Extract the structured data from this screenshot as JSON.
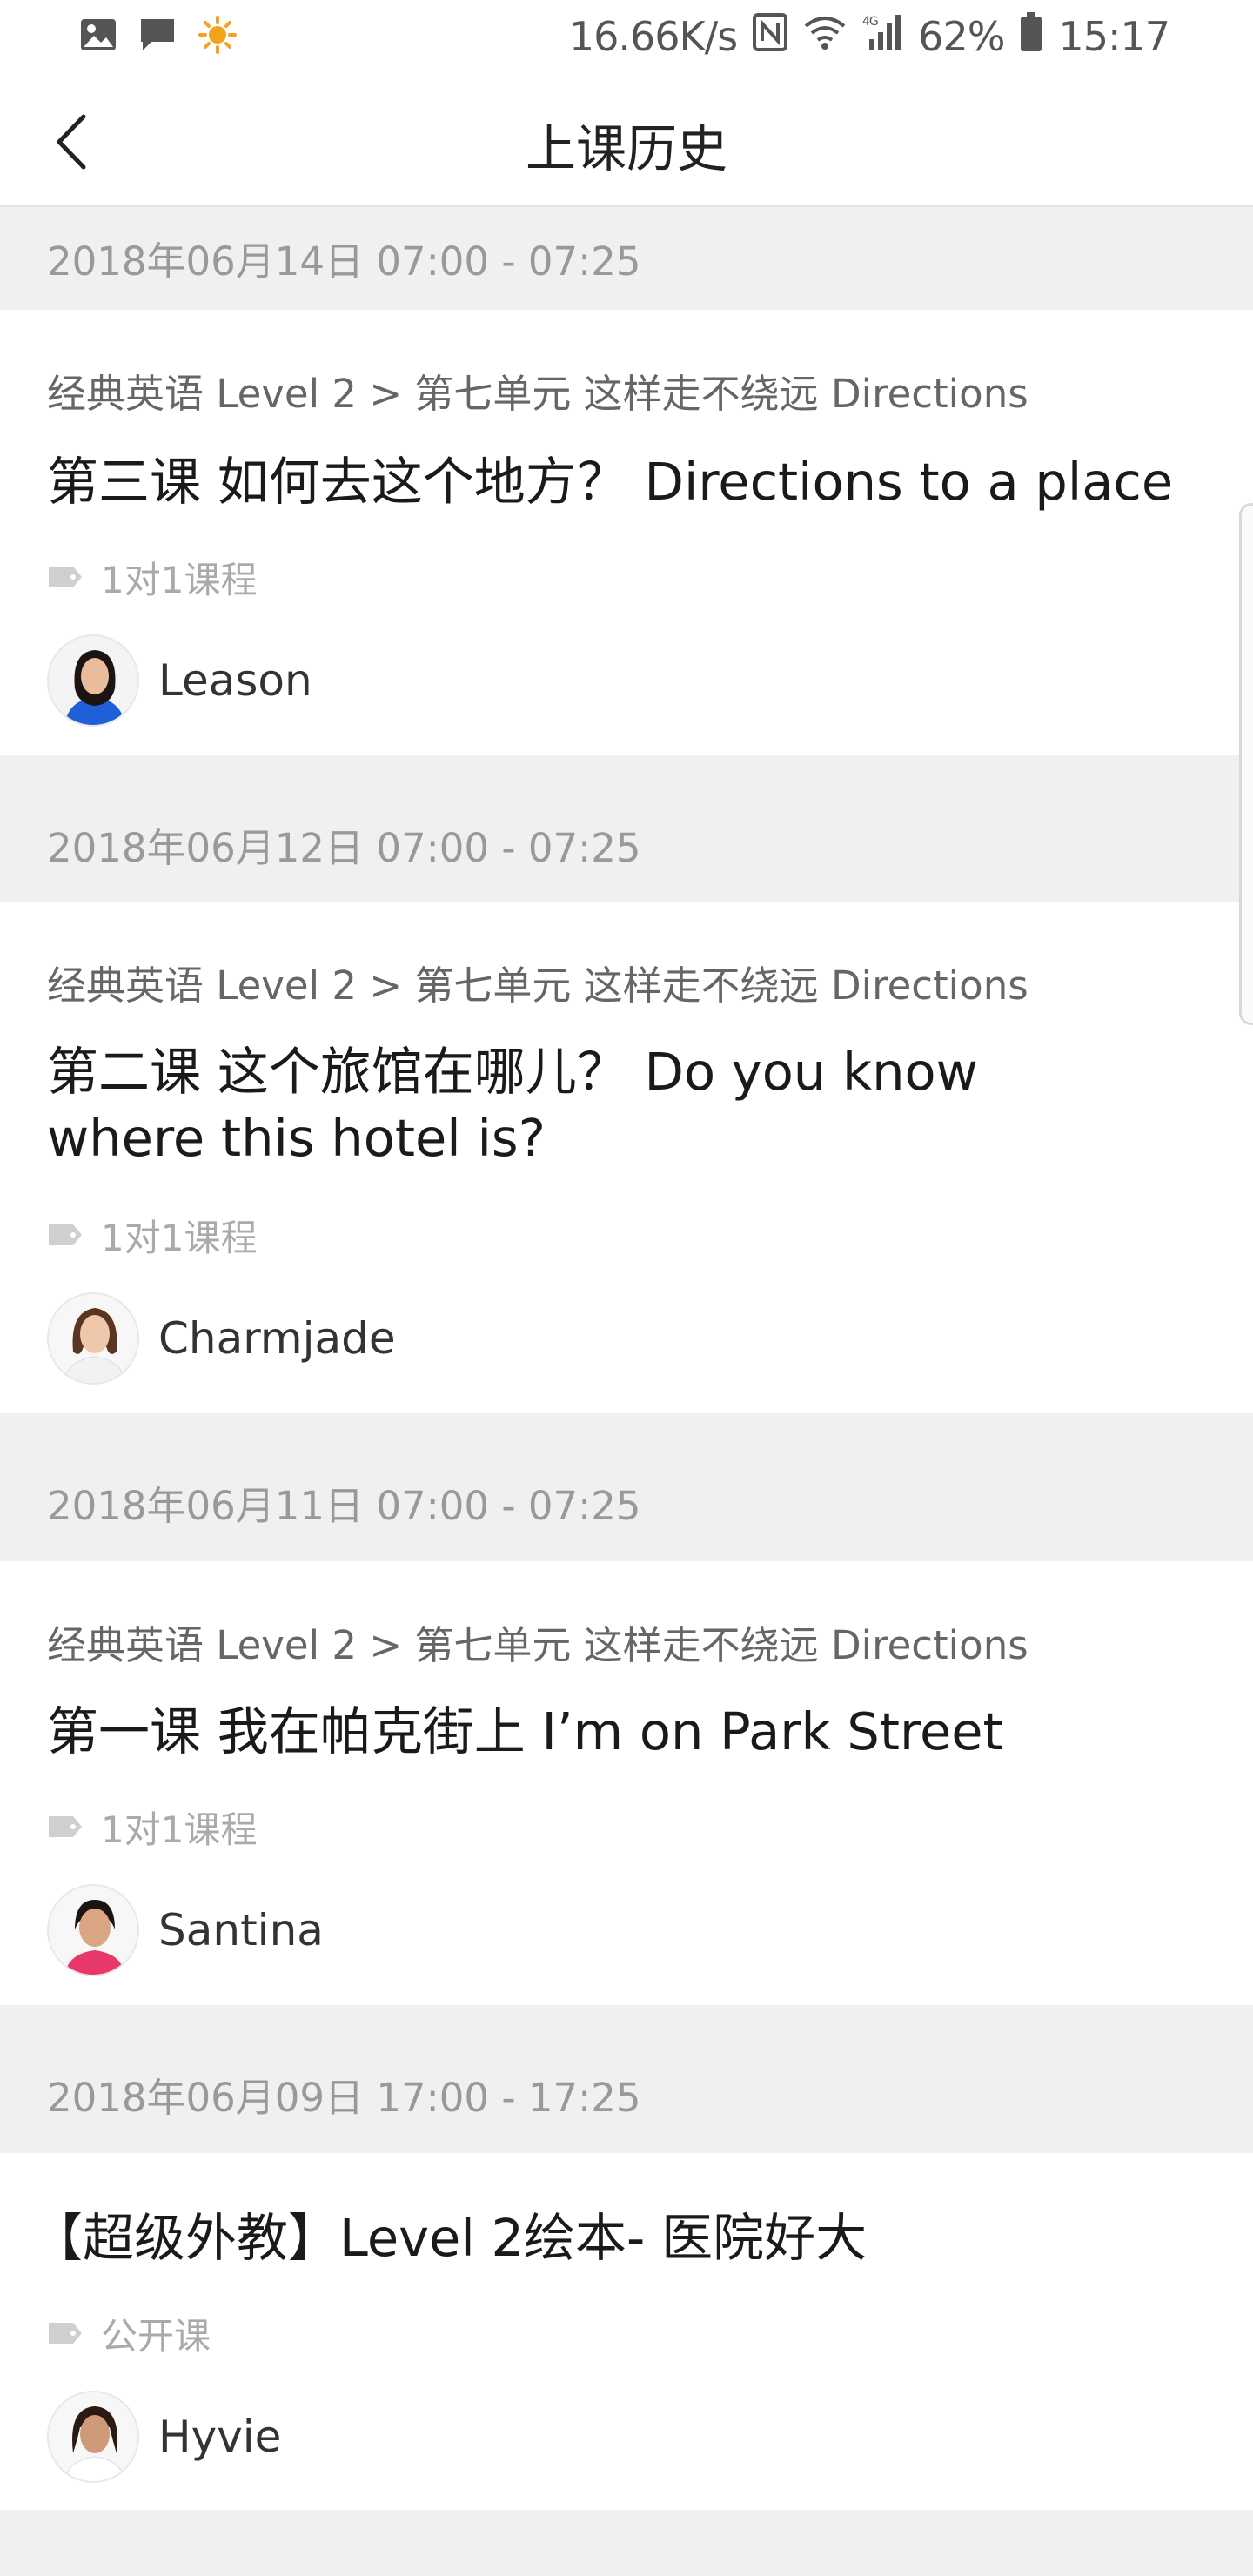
{
  "status_bar": {
    "speed": "16.66K/s",
    "battery": "62%",
    "time": "15:17",
    "left_icons": [
      "image-icon",
      "message-icon",
      "weather-sun-icon"
    ],
    "right_icons": [
      "nfc-icon",
      "wifi-icon",
      "signal-icon",
      "battery-icon"
    ]
  },
  "header": {
    "title": "上课历史",
    "back_icon": "chevron-left-icon"
  },
  "lessons": [
    {
      "date": "2018年06月14日 07:00 - 07:25",
      "crumb": "经典英语 Level 2 > 第七单元 这样走不绕远 Directions",
      "title": "第三课 如何去这个地方？ Directions to a place",
      "tag": "1对1课程",
      "teacher": "Leason",
      "avatar_shirt": "#1f5fd8"
    },
    {
      "date": "2018年06月12日 07:00 - 07:25",
      "crumb": "经典英语 Level 2 > 第七单元 这样走不绕远 Directions",
      "title": "第二课 这个旅馆在哪儿？ Do you know where this hotel is?",
      "tag": "1对1课程",
      "teacher": "Charmjade",
      "avatar_shirt": "#f2f2f2"
    },
    {
      "date": "2018年06月11日 07:00 - 07:25",
      "crumb": "经典英语 Level 2 > 第七单元 这样走不绕远 Directions",
      "title": "第一课 我在帕克街上  I’m on Park Street",
      "tag": "1对1课程",
      "teacher": "Santina",
      "avatar_shirt": "#e8386b"
    },
    {
      "date": "2018年06月09日 17:00 - 17:25",
      "crumb": "",
      "title": "【超级外教】Level 2绘本- 医院好大",
      "tag": "公开课",
      "teacher": "Hyvie",
      "avatar_shirt": "#ffffff"
    }
  ],
  "colors": {
    "page_bg": "#f0f0f0",
    "card_bg": "#ffffff",
    "muted_text": "#999999",
    "tag_text": "#aaaaaa"
  }
}
